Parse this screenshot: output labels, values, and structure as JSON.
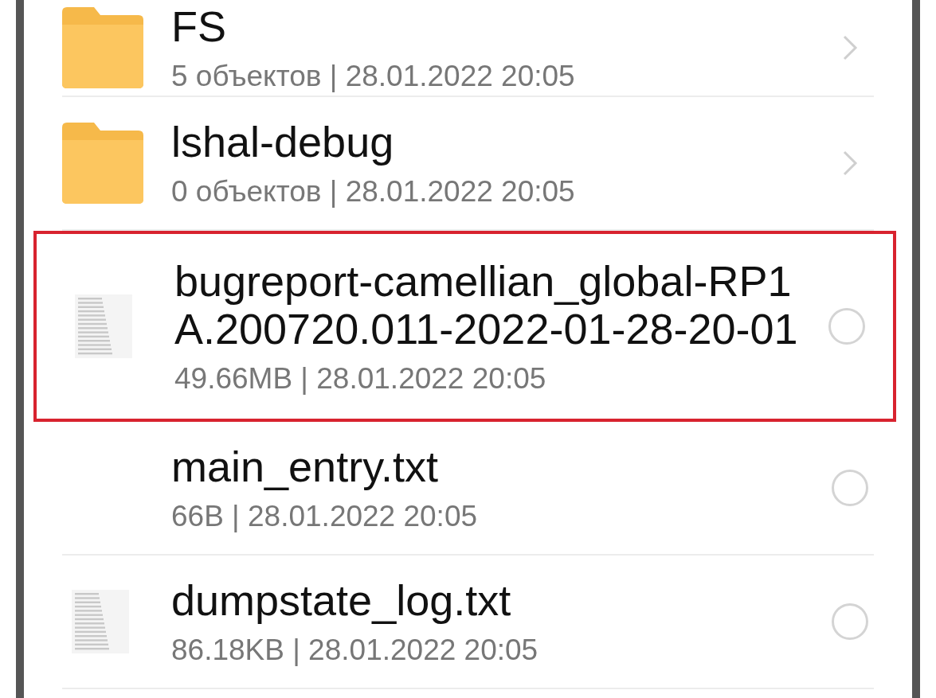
{
  "files": [
    {
      "kind": "folder",
      "name": "FS",
      "details": "5 объектов | 28.01.2022 20:05",
      "selectable": false,
      "highlighted": false
    },
    {
      "kind": "folder",
      "name": "lshal-debug",
      "details": "0 объектов | 28.01.2022 20:05",
      "selectable": false,
      "highlighted": false
    },
    {
      "kind": "document",
      "name": "bugreport-camellian_global-RP1A.200720.011-2022-01-28-20-01",
      "details": "49.66MB | 28.01.2022 20:05",
      "selectable": true,
      "selected": false,
      "highlighted": true
    },
    {
      "kind": "blank",
      "name": "main_entry.txt",
      "details": "66B | 28.01.2022 20:05",
      "selectable": true,
      "selected": false,
      "highlighted": false
    },
    {
      "kind": "document",
      "name": "dumpstate_log.txt",
      "details": "86.18KB | 28.01.2022 20:05",
      "selectable": true,
      "selected": false,
      "highlighted": false
    }
  ]
}
